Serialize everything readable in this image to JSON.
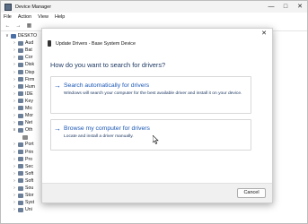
{
  "window": {
    "title": "Device Manager"
  },
  "menu": [
    "File",
    "Action",
    "View",
    "Help"
  ],
  "tree": {
    "root_label": "DESKTO",
    "items": [
      "Aud",
      "Bat",
      "Cor",
      "Disk",
      "Disp",
      "Firm",
      "Hum",
      "IDE",
      "Key",
      "Mic",
      "Mor",
      "Net",
      "Oth",
      "",
      "Port",
      "Prin",
      "Pro",
      "Sec",
      "Soft",
      "Soft",
      "Sou",
      "Stor",
      "Syst",
      "Uni"
    ]
  },
  "dialog": {
    "title": "Update Drivers - Base System Device",
    "question": "How do you want to search for drivers?",
    "option1": {
      "title": "Search automatically for drivers",
      "description": "Windows will search your computer for the best available driver and install it on your device."
    },
    "option2": {
      "title": "Browse my computer for drivers",
      "description": "Locate and install a driver manually."
    },
    "cancel_label": "Cancel"
  }
}
